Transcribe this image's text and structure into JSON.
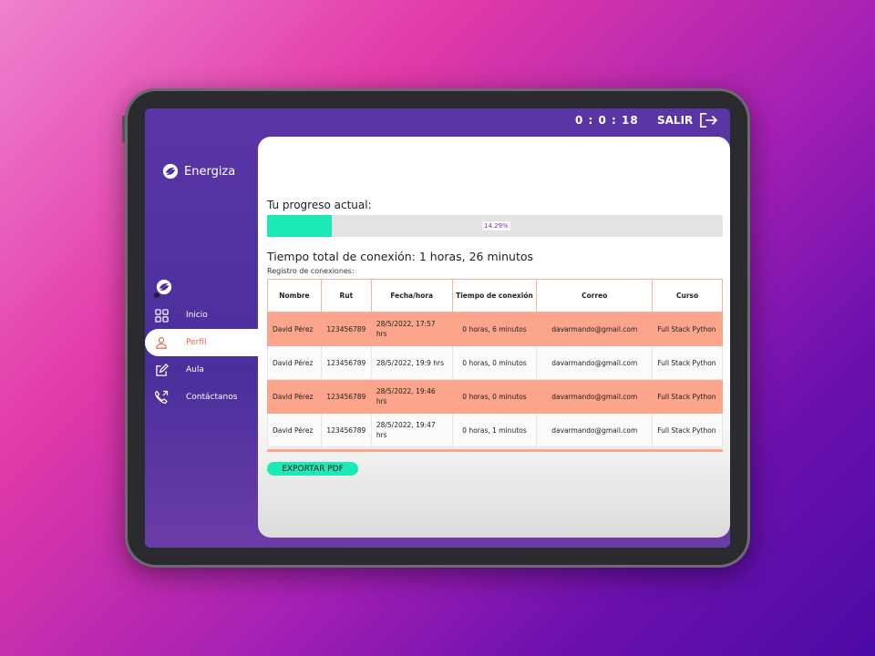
{
  "topbar": {
    "timer": "0 : 0 : 18",
    "logout_label": "SALIR"
  },
  "brand": {
    "name": "Energiza"
  },
  "nav": {
    "items": [
      {
        "label": "Inicio",
        "icon": "grid-icon"
      },
      {
        "label": "Perfil",
        "icon": "user-icon",
        "active": true
      },
      {
        "label": "Aula",
        "icon": "edit-icon"
      },
      {
        "label": "Contáctanos",
        "icon": "phone-icon"
      }
    ]
  },
  "progress": {
    "label": "Tu progreso actual:",
    "value_text": "14.29%",
    "fraction": 0.1429,
    "color": "#1de9b6"
  },
  "connection": {
    "total_text": "Tiempo total de conexión: 1 horas, 26 minutos",
    "log_label": "Registro de conexiones:"
  },
  "table": {
    "headers": [
      "Nombre",
      "Rut",
      "Fecha/hora",
      "Tiempo de conexión",
      "Correo",
      "Curso"
    ],
    "rows": [
      [
        "David Pérez",
        "123456789",
        "28/5/2022, 17:57 hrs",
        "0 horas, 6 minutos",
        "davarmando@gmail.com",
        "Full Stack Python"
      ],
      [
        "David Pérez",
        "123456789",
        "28/5/2022, 19:9 hrs",
        "0 horas, 0 minutos",
        "davarmando@gmail.com",
        "Full Stack Python"
      ],
      [
        "David Pérez",
        "123456789",
        "28/5/2022, 19:46 hrs",
        "0 horas, 0 minutos",
        "davarmando@gmail.com",
        "Full Stack Python"
      ],
      [
        "David Pérez",
        "123456789",
        "28/5/2022, 19:47 hrs",
        "0 horas, 1 minutos",
        "davarmando@gmail.com",
        "Full Stack Python"
      ]
    ]
  },
  "export": {
    "label": "EXPORTAR PDF"
  },
  "colors": {
    "accent": "#1de9b6",
    "row_highlight": "#fca58c",
    "active_nav": "#e7664f",
    "sidebar": "#4a2f9c"
  }
}
